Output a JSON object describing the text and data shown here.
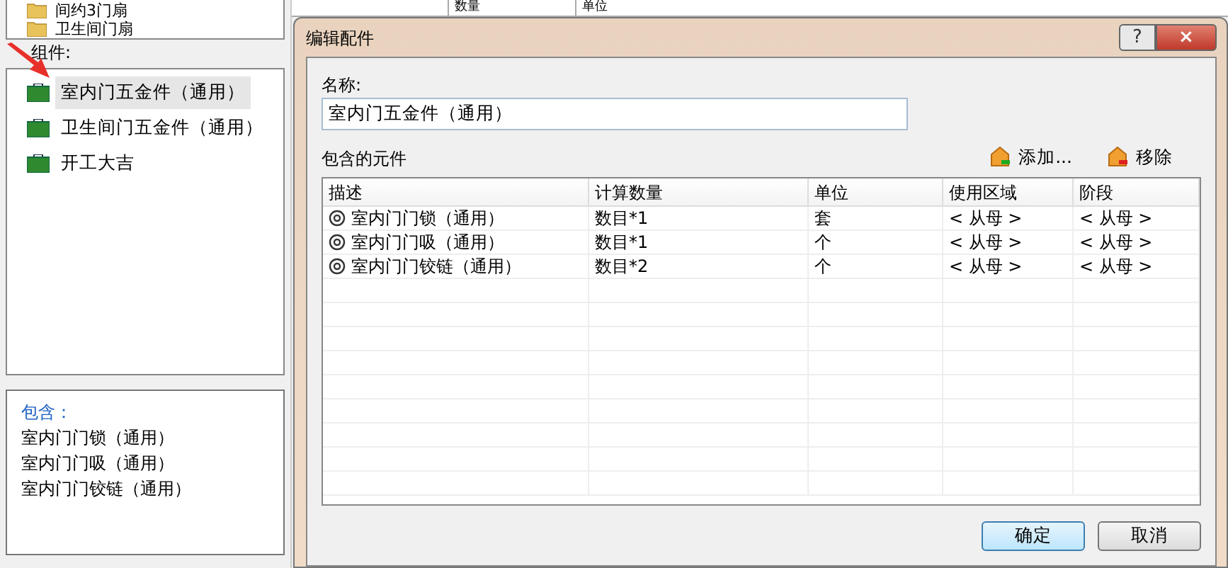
{
  "background": {
    "folders": [
      {
        "label": "间约3门扇"
      },
      {
        "label": "卫生间门扇"
      }
    ],
    "table_columns": [
      "数量",
      "单位"
    ],
    "components_label": "组件:",
    "components": [
      {
        "label": "室内门五金件（通用）",
        "selected": true
      },
      {
        "label": "卫生间门五金件（通用）",
        "selected": false
      },
      {
        "label": "开工大吉",
        "selected": false
      }
    ],
    "contains": {
      "title": "包含：",
      "items": [
        "室内门门锁（通用）",
        "室内门门吸（通用）",
        "室内门门铰链（通用）"
      ]
    }
  },
  "dialog": {
    "title": "编辑配件",
    "help": "?",
    "close": "×",
    "name_label": "名称:",
    "name_value": "室内门五金件（通用）",
    "parts_label": "包含的元件",
    "add": "添加...",
    "remove": "移除",
    "columns": [
      "描述",
      "计算数量",
      "单位",
      "使用区域",
      "阶段"
    ],
    "rows": [
      [
        "室内门门锁（通用）",
        "数目*1",
        "套",
        "< 从母 >",
        "< 从母 >"
      ],
      [
        "室内门门吸（通用）",
        "数目*1",
        "个",
        "< 从母 >",
        "< 从母 >"
      ],
      [
        "室内门门铰链（通用）",
        "数目*2",
        "个",
        "< 从母 >",
        "< 从母 >"
      ]
    ],
    "ok": "确定",
    "cancel": "取消"
  }
}
